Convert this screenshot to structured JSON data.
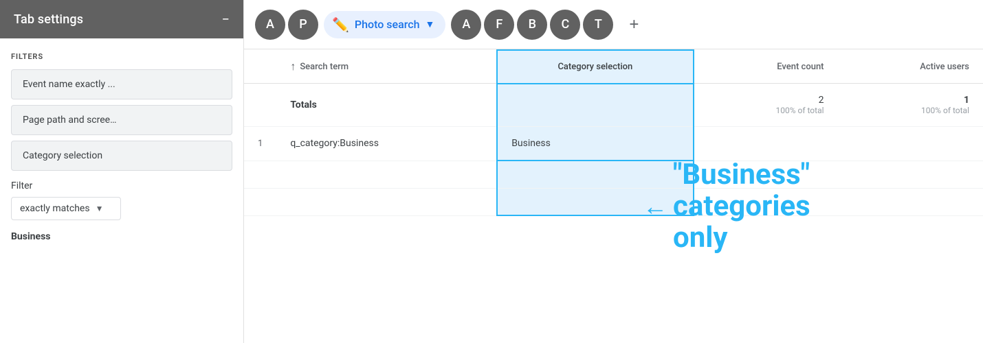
{
  "sidebar": {
    "title": "Tab settings",
    "minus_label": "−",
    "filters_label": "FILTERS",
    "filter_pills": [
      {
        "id": "event-name",
        "label": "Event name exactly ..."
      },
      {
        "id": "page-path",
        "label": "Page path and scree…"
      },
      {
        "id": "category",
        "label": "Category selection"
      }
    ],
    "filter_section_label": "Filter",
    "filter_dropdown_label": "exactly matches",
    "filter_value": "Business"
  },
  "tabbar": {
    "tabs": [
      {
        "id": "a1",
        "letter": "A",
        "color": "dark"
      },
      {
        "id": "p",
        "letter": "P",
        "color": "dark"
      },
      {
        "id": "photo-search",
        "label": "Photo search",
        "active": true
      },
      {
        "id": "a2",
        "letter": "A",
        "color": "dark"
      },
      {
        "id": "f",
        "letter": "F",
        "color": "dark"
      },
      {
        "id": "b",
        "letter": "B",
        "color": "dark"
      },
      {
        "id": "c",
        "letter": "C",
        "color": "dark"
      },
      {
        "id": "t",
        "letter": "T",
        "color": "dark"
      }
    ],
    "add_label": "+"
  },
  "table": {
    "columns": [
      {
        "id": "row-num",
        "label": ""
      },
      {
        "id": "search-term",
        "label": "Search term"
      },
      {
        "id": "category-selection",
        "label": "Category selection",
        "highlighted": true
      },
      {
        "id": "event-count",
        "label": "Event count",
        "numeric": true
      },
      {
        "id": "active-users",
        "label": "Active users",
        "numeric": true
      }
    ],
    "totals_row": {
      "label": "Totals",
      "event_count": "2",
      "event_count_sub": "100% of total",
      "active_users": "1",
      "active_users_sub": "100% of total"
    },
    "rows": [
      {
        "num": "1",
        "search_term": "q_category:Business",
        "category": "Business",
        "event_count": "",
        "active_users": ""
      }
    ]
  },
  "annotation": {
    "text": "\"Business\"\ncategories\nonly"
  }
}
